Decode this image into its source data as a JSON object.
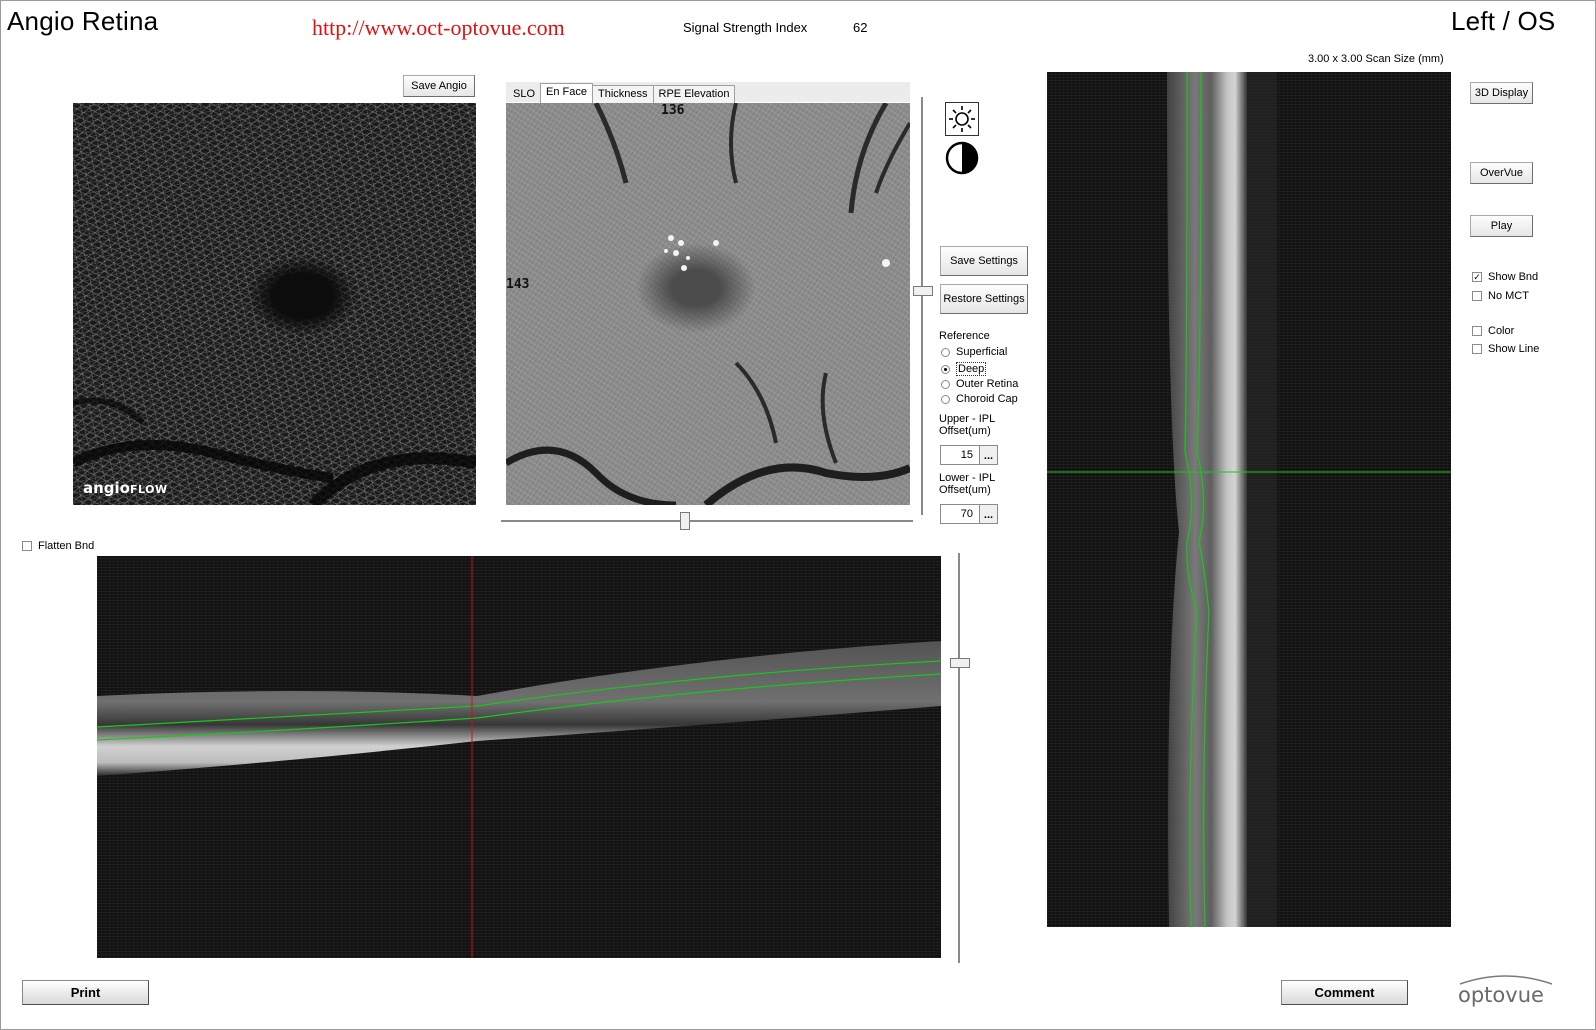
{
  "header": {
    "app_title": "Angio Retina",
    "url": "http://www.oct-optovue.com",
    "signal_label": "Signal Strength Index",
    "signal_value": "62",
    "eye": "Left / OS",
    "scan_size": "3.00 x 3.00 Scan Size (mm)"
  },
  "angio_panel": {
    "save_label": "Save Angio",
    "logo_bold": "angio",
    "logo_rest": "FLOW"
  },
  "enface_panel": {
    "tabs": [
      "SLO",
      "En Face",
      "Thickness",
      "RPE Elevation"
    ],
    "active_tab": "En Face",
    "label_top": "136",
    "label_left": "143"
  },
  "controls": {
    "brightness_icon": "sun-icon",
    "contrast_icon": "contrast-icon",
    "save_settings": "Save Settings",
    "restore_settings": "Restore Settings",
    "reference_label": "Reference",
    "reference_options": [
      "Superficial",
      "Deep",
      "Outer Retina",
      "Choroid Cap"
    ],
    "reference_selected": "Deep",
    "upper_label_1": "Upper - IPL",
    "upper_label_2": "Offset(um)",
    "upper_value": "15",
    "lower_label_1": "Lower - IPL",
    "lower_label_2": "Offset(um)",
    "lower_value": "70",
    "browse": "..."
  },
  "right_panel": {
    "display_3d": "3D Display",
    "overvue": "OverVue",
    "play": "Play",
    "options": [
      {
        "label": "Show Bnd",
        "checked": true
      },
      {
        "label": "No MCT",
        "checked": false
      },
      {
        "label": "Color",
        "checked": false
      },
      {
        "label": "Show Line",
        "checked": false
      }
    ]
  },
  "bscan_panel": {
    "flatten_label": "Flatten Bnd",
    "flatten_checked": false
  },
  "footer": {
    "print": "Print",
    "comment": "Comment",
    "brand": "optovue"
  },
  "colors": {
    "url_red": "#e01010",
    "boundary_green": "#18c818",
    "cursor_red": "#d01010",
    "brand_blue": "#1e6fb8"
  }
}
